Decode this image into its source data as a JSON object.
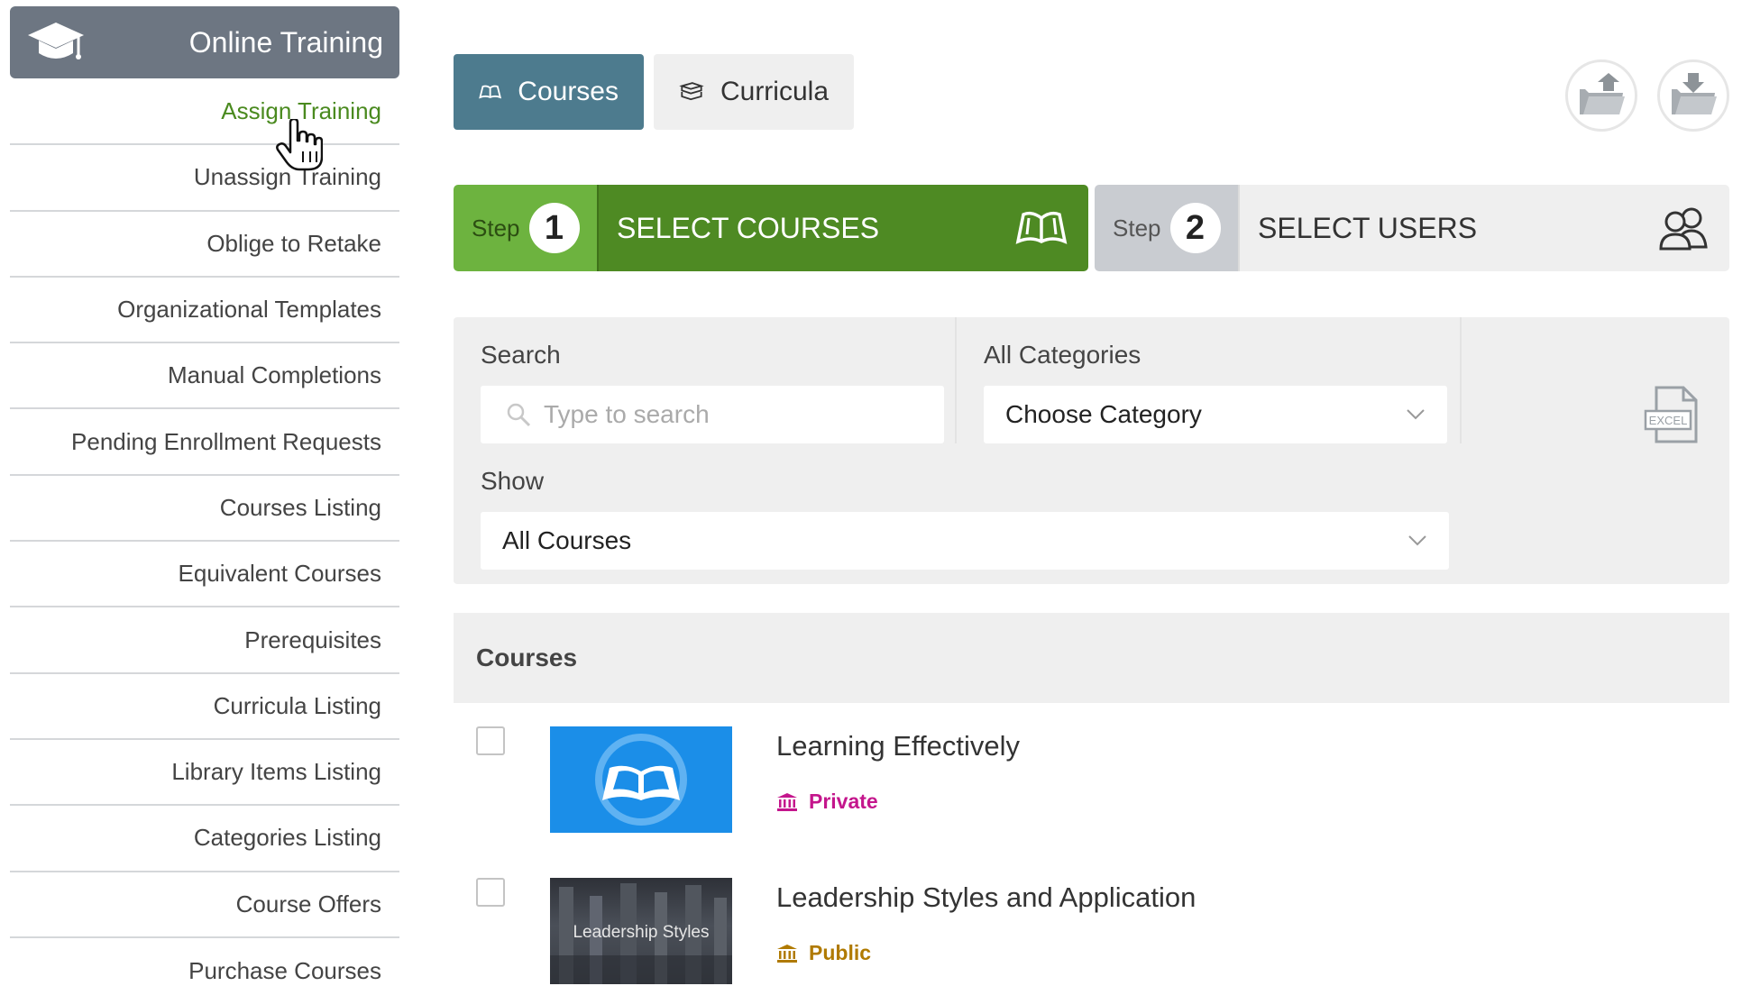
{
  "sidebar": {
    "header_title": "Online Training",
    "items": [
      {
        "label": "Assign Training",
        "active": true
      },
      {
        "label": "Unassign Training"
      },
      {
        "label": "Oblige to Retake"
      },
      {
        "label": "Organizational Templates"
      },
      {
        "label": "Manual Completions"
      },
      {
        "label": "Pending Enrollment Requests"
      },
      {
        "label": "Courses Listing"
      },
      {
        "label": "Equivalent Courses"
      },
      {
        "label": "Prerequisites"
      },
      {
        "label": "Curricula Listing"
      },
      {
        "label": "Library Items Listing"
      },
      {
        "label": "Categories Listing"
      },
      {
        "label": "Course Offers"
      },
      {
        "label": "Purchase Courses"
      }
    ]
  },
  "tabs": {
    "courses": "Courses",
    "curricula": "Curricula"
  },
  "steps": {
    "step_word": "Step",
    "step1_num": "1",
    "step1_label": "SELECT COURSES",
    "step2_num": "2",
    "step2_label": "SELECT USERS"
  },
  "filters": {
    "search_label": "Search",
    "search_placeholder": "Type to search",
    "category_label": "All Categories",
    "category_value": "Choose Category",
    "show_label": "Show",
    "show_value": "All Courses",
    "excel_text": "EXCEL"
  },
  "courses": {
    "header": "Courses",
    "items": [
      {
        "title": "Learning Effectively",
        "visibility": "Private",
        "visibility_color": "#c4168c"
      },
      {
        "title": "Leadership Styles and Application",
        "visibility": "Public",
        "visibility_color": "#b07a00",
        "thumb_text": "Leadership Styles"
      }
    ]
  },
  "colors": {
    "sidebar_header": "#6d7682",
    "tab_active": "#4d7b8e",
    "step_active": "#4e8a23",
    "step_active_num": "#6db33f",
    "active_link": "#4a8a1f"
  }
}
